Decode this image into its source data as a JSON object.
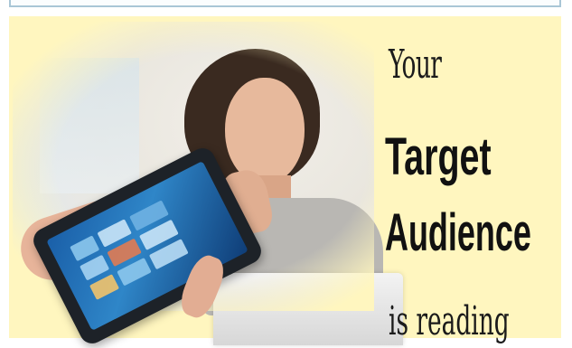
{
  "banner": {
    "line1": "Your",
    "line2": "Target",
    "line3": "Audience",
    "line4": "is reading"
  },
  "colors": {
    "background": "#fff6bf",
    "frame": "#a9c6d6",
    "text": "#111111"
  },
  "image": {
    "icon": "photo-woman-with-tablet"
  }
}
